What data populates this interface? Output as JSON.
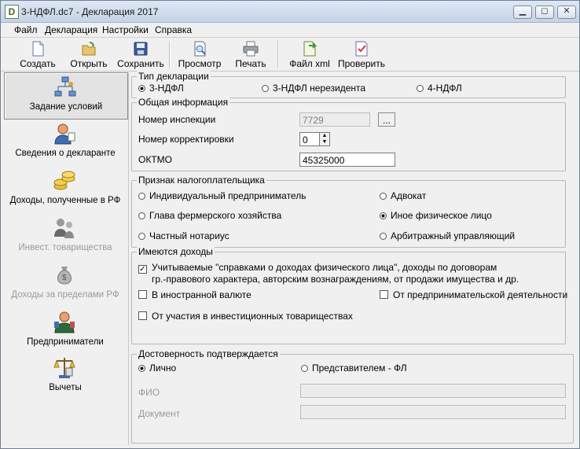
{
  "window": {
    "title": "3-НДФЛ.dc7 - Декларация 2017",
    "icon_letter": "D"
  },
  "menu": [
    "Файл",
    "Декларация",
    "Настройки",
    "Справка"
  ],
  "toolbar": {
    "create": "Создать",
    "open": "Открыть",
    "save": "Сохранить",
    "preview": "Просмотр",
    "print": "Печать",
    "xml": "Файл xml",
    "check": "Проверить"
  },
  "sidebar": [
    {
      "label": "Задание условий",
      "active": true,
      "disabled": false
    },
    {
      "label": "Сведения о декларанте",
      "active": false,
      "disabled": false
    },
    {
      "label": "Доходы, полученные в РФ",
      "active": false,
      "disabled": false
    },
    {
      "label": "Инвест. товарищества",
      "active": false,
      "disabled": true
    },
    {
      "label": "Доходы за пределами РФ",
      "active": false,
      "disabled": true
    },
    {
      "label": "Предприниматели",
      "active": false,
      "disabled": false
    },
    {
      "label": "Вычеты",
      "active": false,
      "disabled": false
    }
  ],
  "decl_type": {
    "title": "Тип декларации",
    "options": [
      "3-НДФЛ",
      "3-НДФЛ нерезидента",
      "4-НДФЛ"
    ],
    "selected": 0
  },
  "general": {
    "title": "Общая информация",
    "inspection_label": "Номер инспекции",
    "inspection_value": "7729",
    "browse_label": "...",
    "correction_label": "Номер корректировки",
    "correction_value": "0",
    "oktmo_label": "ОКТМО",
    "oktmo_value": "45325000"
  },
  "taxpayer": {
    "title": "Признак налогоплательщика",
    "options": [
      "Индивидуальный предприниматель",
      "Адвокат",
      "Глава фермерского хозяйства",
      "Иное физическое лицо",
      "Частный нотариус",
      "Арбитражный управляющий"
    ],
    "selected": 3
  },
  "income": {
    "title": "Имеются доходы",
    "main_line1": "Учитываемые \"справками о доходах физического лица\", доходы по договорам",
    "main_line2": "гр.-правового характера, авторским вознаграждениям, от продажи имущества и др.",
    "main_checked": true,
    "foreign": "В иностранной валюте",
    "entrepreneur": "От предпринимательской деятельности",
    "invest": "От участия в инвестиционных товариществах"
  },
  "confirm": {
    "title": "Достоверность подтверждается",
    "options": [
      "Лично",
      "Представителем - ФЛ"
    ],
    "selected": 0,
    "fio_label": "ФИО",
    "doc_label": "Документ"
  }
}
